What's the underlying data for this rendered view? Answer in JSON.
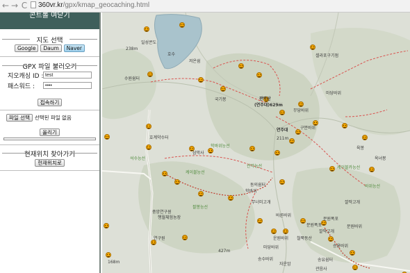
{
  "browser": {
    "back_glyph": "←",
    "forward_glyph": "→",
    "reload_glyph": "C",
    "url_host": "360vr.kr",
    "url_path": "/gpx/kmap_geocaching.html"
  },
  "panel": {
    "title": "콘트롤 여닫기",
    "map_select": {
      "heading": "지도 선택",
      "buttons": [
        "Google",
        "Daum",
        "Naver"
      ],
      "active": "Naver"
    },
    "gpx_load": {
      "heading": "GPX 파일 불러오기",
      "id_label": "지오캐싱 ID :",
      "id_value": "test",
      "password_label": "패스워드 :",
      "password_value": "••••",
      "connect_button": "접속하기",
      "file_button": "파일 선택",
      "file_status": "선택된 파일 없음",
      "upload_button": "올리기"
    },
    "locate": {
      "heading": "현재위치 찾아가기",
      "button": "현재위치로"
    }
  },
  "map": {
    "colors": {
      "base": "#dde0d7",
      "forest": "#cdd6c4",
      "lake": "#9fbdc9",
      "trail": "#d9534f",
      "route": "#c0392b",
      "marker": "#f2a600"
    },
    "labels": {
      "l1": "일성콘도",
      "l2": "저온쉼",
      "l3": "수원쉼터",
      "l4": "238m",
      "l5": "211m",
      "l6": "셀라포구기점",
      "l7": "관악산",
      "l8": "(연주대)629m",
      "l9": "국기봉",
      "l10": "무당바위",
      "l11": "연주대",
      "l12": "마당바위",
      "l13": "구분바위",
      "l14": "학바위능선",
      "l15": "호계약수터",
      "l16": "육봉",
      "l17": "케이블카능선",
      "l18": "삼막사",
      "l19": "팔봉능선",
      "l20": "동의쉼터",
      "l21": "학바위",
      "l22": "무너미고개",
      "l23": "송유쉼터",
      "l24": "문원폭포",
      "l25": "깔딱고개",
      "l26": "운원바위",
      "l27": "마당바위",
      "l28": "자운암",
      "l29": "427m",
      "l30": "관음사",
      "l31": "바위능선",
      "l32": "옥녀봉",
      "l33": "승용바위",
      "l34": "바른바위",
      "l35": "철쭉동산",
      "l36": "관악능선",
      "l37": "문원폭포",
      "l38": "깔딱고개",
      "l39": "중앙연구원",
      "l40": "송수바위",
      "l41": "케이블능선",
      "l42": "문원바위",
      "l43": "연구원",
      "l44": "행월체험농장",
      "l45": "석수능선",
      "l46": "168m",
      "l47": "호수"
    }
  }
}
